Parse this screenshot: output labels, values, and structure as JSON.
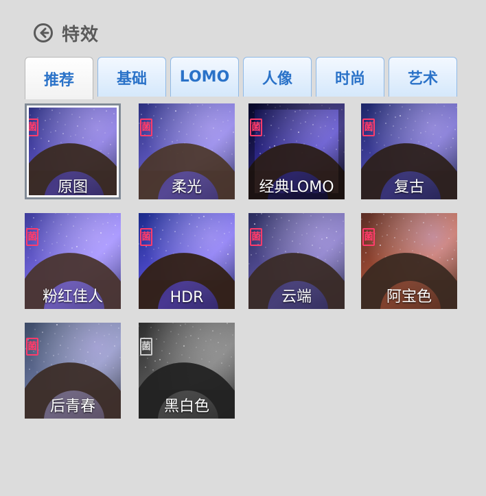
{
  "header": {
    "title": "特效",
    "back_icon": "back-arrow-circle-icon"
  },
  "tabs": [
    {
      "label": "推荐",
      "active": true
    },
    {
      "label": "基础",
      "active": false
    },
    {
      "label": "LOMO",
      "active": false
    },
    {
      "label": "人像",
      "active": false
    },
    {
      "label": "时尚",
      "active": false
    },
    {
      "label": "艺术",
      "active": false
    }
  ],
  "effects": [
    {
      "label": "原图",
      "selected": true,
      "stamp": "菌"
    },
    {
      "label": "柔光",
      "selected": false,
      "stamp": "菌"
    },
    {
      "label": "经典LOMO",
      "selected": false,
      "stamp": "菌"
    },
    {
      "label": "复古",
      "selected": false,
      "stamp": "菌"
    },
    {
      "label": "粉红佳人",
      "selected": false,
      "stamp": "菌"
    },
    {
      "label": "HDR",
      "selected": false,
      "stamp": "菌"
    },
    {
      "label": "云端",
      "selected": false,
      "stamp": "菌"
    },
    {
      "label": "阿宝色",
      "selected": false,
      "stamp": "菌"
    },
    {
      "label": "后青春",
      "selected": false,
      "stamp": "菌"
    },
    {
      "label": "黑白色",
      "selected": false,
      "stamp": "菌"
    }
  ]
}
